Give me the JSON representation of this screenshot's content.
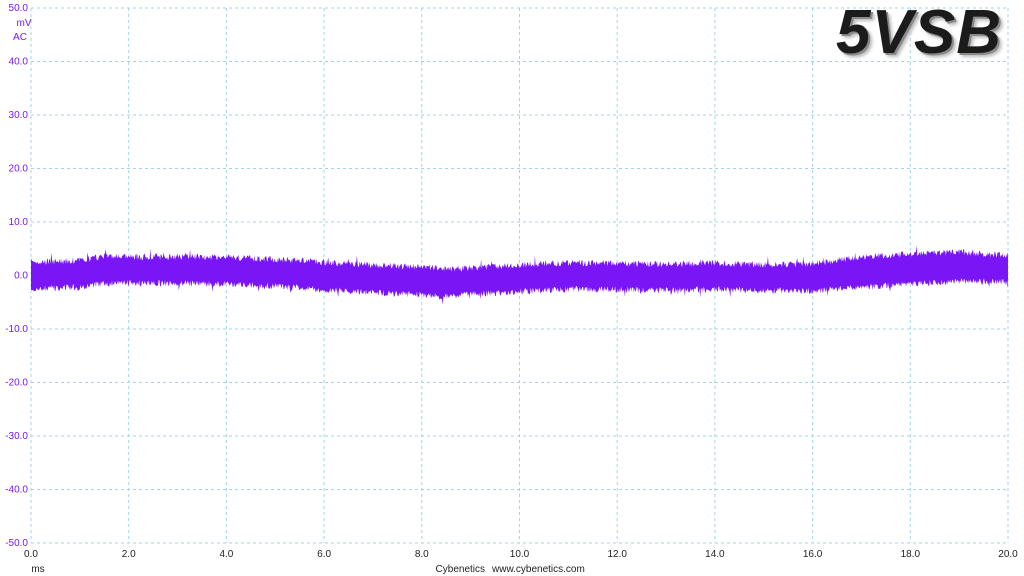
{
  "title": "5VSB",
  "footer": {
    "brand": "Cybenetics",
    "url": "www.cybenetics.com"
  },
  "chart_data": {
    "type": "line",
    "title": "5VSB",
    "xlabel": "ms",
    "ylabel": "mV",
    "ylabel_sub": "AC",
    "xlim": [
      0.0,
      20.0
    ],
    "ylim": [
      -50.0,
      50.0
    ],
    "xticks": [
      0.0,
      2.0,
      4.0,
      6.0,
      8.0,
      10.0,
      12.0,
      14.0,
      16.0,
      18.0,
      20.0
    ],
    "xtick_labels": [
      "0.0",
      "2.0",
      "4.0",
      "6.0",
      "8.0",
      "10.0",
      "12.0",
      "14.0",
      "16.0",
      "18.0",
      "20.0"
    ],
    "yticks": [
      50.0,
      40.0,
      30.0,
      20.0,
      10.0,
      0.0,
      -10.0,
      -20.0,
      -30.0,
      -40.0,
      -50.0
    ],
    "ytick_labels": [
      "50.0",
      "40.0",
      "30.0",
      "20.0",
      "10.0",
      "0.0",
      "-10.0",
      "-20.0",
      "-30.0",
      "-40.0",
      "-50.0"
    ],
    "grid": true,
    "series": [
      {
        "color": "#7a16f5",
        "x": [
          0.0,
          1.0,
          1.5,
          2.0,
          3.0,
          4.0,
          5.0,
          6.0,
          7.0,
          8.0,
          8.5,
          9.0,
          10.0,
          11.0,
          12.0,
          13.0,
          14.0,
          15.0,
          16.0,
          17.0,
          18.0,
          19.0,
          20.0
        ],
        "upper": [
          2.5,
          2.8,
          3.6,
          3.4,
          3.6,
          3.5,
          3.0,
          2.5,
          2.0,
          1.6,
          1.2,
          1.4,
          2.0,
          2.4,
          2.3,
          2.1,
          2.3,
          2.0,
          2.2,
          3.5,
          4.0,
          4.4,
          3.8
        ],
        "lower": [
          -2.4,
          -2.2,
          -1.5,
          -1.4,
          -1.5,
          -1.6,
          -2.0,
          -2.6,
          -3.2,
          -3.6,
          -4.0,
          -3.5,
          -3.0,
          -2.6,
          -2.6,
          -2.8,
          -2.6,
          -2.8,
          -2.9,
          -2.2,
          -1.6,
          -1.0,
          -1.2
        ],
        "noise_pp": 2.5
      }
    ]
  }
}
